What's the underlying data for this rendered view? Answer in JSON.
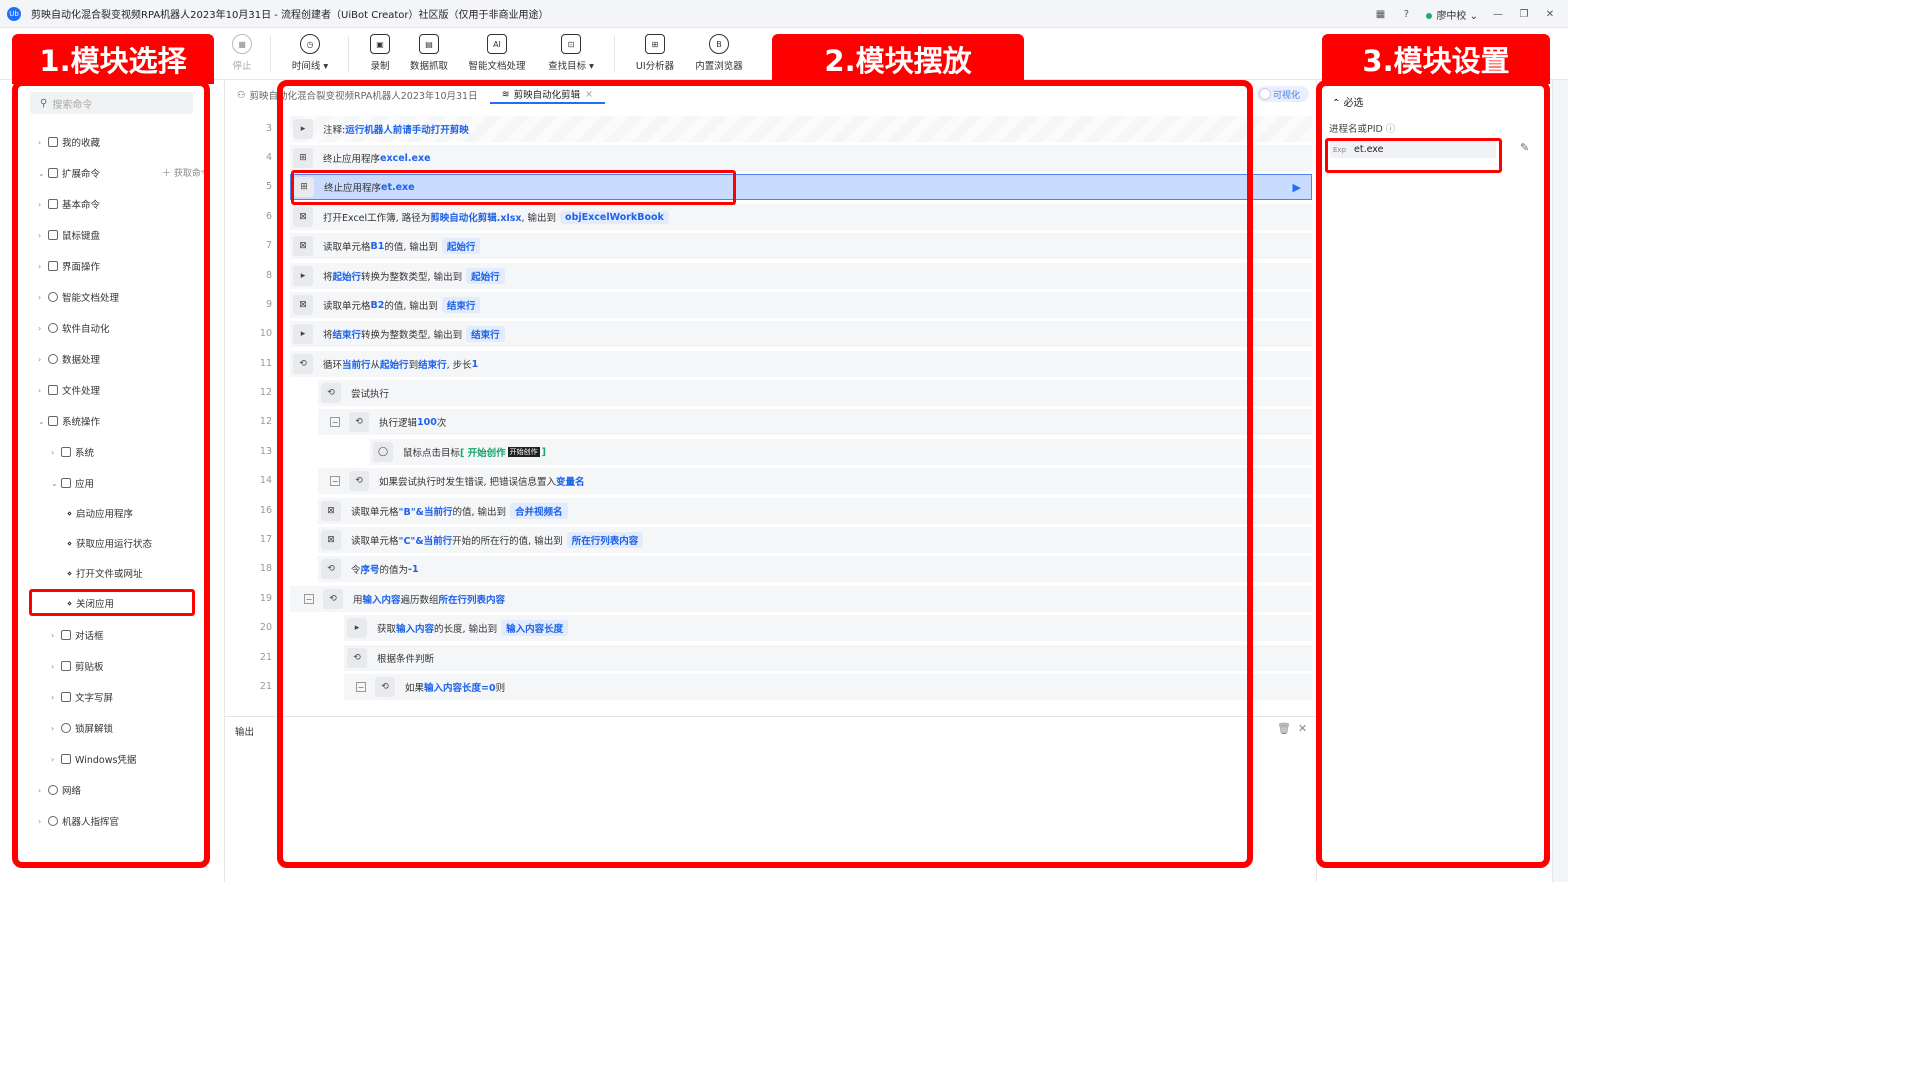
{
  "window": {
    "title": "剪映自动化混合裂变视频RPA机器人2023年10月31日 - 流程创建者（UiBot Creator）社区版（仅用于非商业用途）",
    "user": "廖中校",
    "app_logo": "Ub"
  },
  "toolbar": {
    "stop": "停止",
    "timeline": "时间线",
    "record": "录制",
    "data_scrape": "数据抓取",
    "smart_doc": "智能文档处理",
    "find_target": "查找目标",
    "ui_analyzer": "UI分析器",
    "builtin_browser": "内置浏览器"
  },
  "banners": {
    "left": "1.模块选择",
    "center": "2.模块摆放",
    "right": "3.模块设置"
  },
  "sidebar": {
    "search_placeholder": "搜索命令",
    "fetch_cmd": "获取命令",
    "items": [
      {
        "label": "我的收藏"
      },
      {
        "label": "扩展命令"
      },
      {
        "label": "基本命令"
      },
      {
        "label": "鼠标键盘"
      },
      {
        "label": "界面操作"
      },
      {
        "label": "智能文档处理"
      },
      {
        "label": "软件自动化"
      },
      {
        "label": "数据处理"
      },
      {
        "label": "文件处理"
      },
      {
        "label": "系统操作"
      },
      {
        "label": "系统"
      },
      {
        "label": "应用"
      },
      {
        "label": "启动应用程序"
      },
      {
        "label": "获取应用运行状态"
      },
      {
        "label": "打开文件或网址"
      },
      {
        "label": "关闭应用"
      },
      {
        "label": "对话框"
      },
      {
        "label": "剪贴板"
      },
      {
        "label": "文字写屏"
      },
      {
        "label": "锁屏解锁"
      },
      {
        "label": "Windows凭据"
      },
      {
        "label": "网络"
      },
      {
        "label": "机器人指挥官"
      }
    ]
  },
  "tabs": {
    "tab1": "剪映自动化混合裂变视频RPA机器人2023年10月31日",
    "tab2": "剪映自动化剪辑",
    "visualize": "可视化"
  },
  "code_rows": [
    {
      "line": "3",
      "parts": [
        "注释: ",
        "运行机器人前请手动打开剪映"
      ]
    },
    {
      "line": "4",
      "parts": [
        "终止应用程序 ",
        "excel.exe"
      ]
    },
    {
      "line": "5",
      "parts": [
        "终止应用程序 ",
        "et.exe"
      ]
    },
    {
      "line": "6",
      "parts": [
        "打开Excel工作簿, 路径为 ",
        "剪映自动化剪辑.xlsx",
        ", 输出到 ",
        "objExcelWorkBook"
      ]
    },
    {
      "line": "7",
      "parts": [
        "读取单元格 ",
        "B1",
        " 的值, 输出到 ",
        "起始行"
      ]
    },
    {
      "line": "8",
      "parts": [
        "将 ",
        "起始行",
        " 转换为整数类型, 输出到 ",
        "起始行"
      ]
    },
    {
      "line": "9",
      "parts": [
        "读取单元格 ",
        "B2",
        " 的值, 输出到 ",
        "结束行"
      ]
    },
    {
      "line": "10",
      "parts": [
        "将 ",
        "结束行",
        " 转换为整数类型, 输出到 ",
        "结束行"
      ]
    },
    {
      "line": "11",
      "parts": [
        "循环 ",
        "当前行",
        " 从 ",
        "起始行",
        " 到 ",
        "结束行",
        " , 步长 ",
        "1"
      ]
    },
    {
      "line": "12",
      "parts": [
        "尝试执行"
      ]
    },
    {
      "line": "12",
      "parts": [
        "执行逻辑 ",
        "100",
        " 次"
      ]
    },
    {
      "line": "13",
      "parts": [
        "鼠标点击目标 ",
        "[ 开始创作 ",
        "开始创作",
        " ]"
      ]
    },
    {
      "line": "14",
      "parts": [
        "如果尝试执行时发生错误, 把错误信息置入 ",
        "变量名"
      ]
    },
    {
      "line": "16",
      "parts": [
        "读取单元格 ",
        "\"B\"&当前行",
        " 的值, 输出到 ",
        "合并视频名"
      ]
    },
    {
      "line": "17",
      "parts": [
        "读取单元格 ",
        "\"C\"&当前行",
        " 开始的所在行的值, 输出到 ",
        "所在行列表内容"
      ]
    },
    {
      "line": "18",
      "parts": [
        "令 ",
        "序号",
        " 的值为 ",
        "-1"
      ]
    },
    {
      "line": "19",
      "parts": [
        "用 ",
        "输入内容",
        " 遍历数组 ",
        "所在行列表内容"
      ]
    },
    {
      "line": "20",
      "parts": [
        "获取 ",
        "输入内容",
        " 的长度, 输出到 ",
        "输入内容长度"
      ]
    },
    {
      "line": "21",
      "parts": [
        "根据条件判断"
      ]
    },
    {
      "line": "21",
      "parts": [
        "如果 ",
        "输入内容长度=0",
        " 则"
      ]
    }
  ],
  "output": {
    "label": "输出"
  },
  "properties": {
    "section": "必选",
    "pid_label": "进程名或PID",
    "pid_prefix": "Exp",
    "pid_value": "et.exe"
  },
  "colors": {
    "accent": "#1e6fff",
    "annotation_red": "#ff0000",
    "selected_row": "#c9dbff"
  }
}
